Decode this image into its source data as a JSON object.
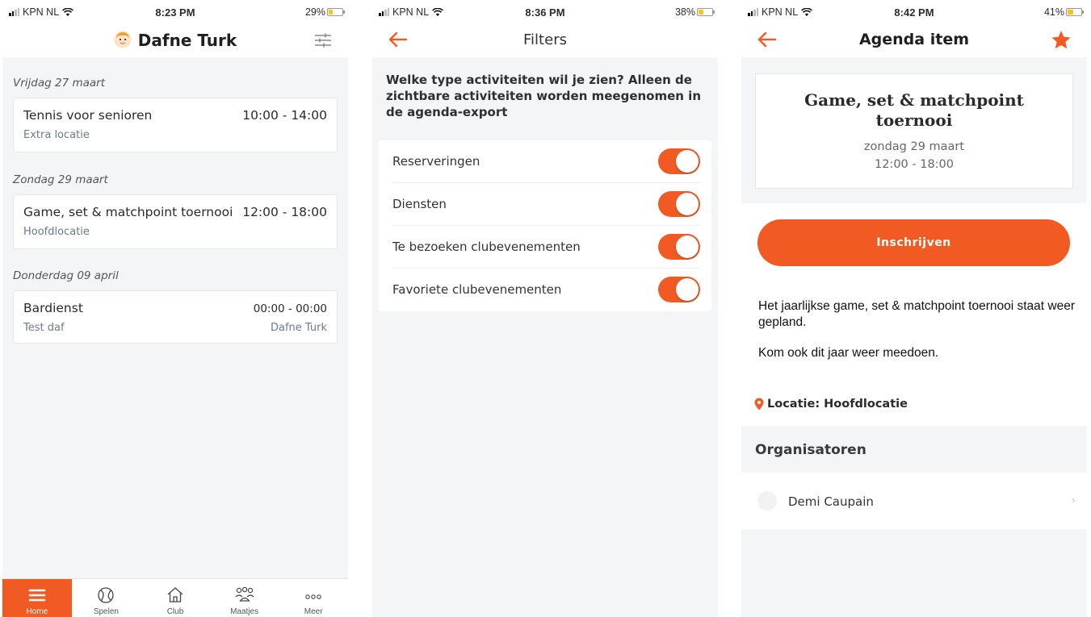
{
  "colors": {
    "accent": "#f15a22",
    "background": "#f4f5f7",
    "card": "#ffffff",
    "muted_text": "#6b7a8a"
  },
  "screens": [
    {
      "status": {
        "carrier": "KPN NL",
        "time": "8:23 PM",
        "battery": "29%",
        "battery_level": 0.29
      },
      "header": {
        "title": "Dafne Turk",
        "avatar_icon": "user-avatar-icon",
        "action_icon": "sliders-icon"
      },
      "sections": [
        {
          "date": "Vrijdag 27 maart",
          "events": [
            {
              "title": "Tennis voor senioren",
              "time": "10:00 - 14:00",
              "location": "Extra locatie",
              "extra": ""
            }
          ]
        },
        {
          "date": "Zondag 29 maart",
          "events": [
            {
              "title": "Game, set & matchpoint toernooi",
              "time": "12:00 - 18:00",
              "location": "Hoofdlocatie",
              "extra": ""
            }
          ]
        },
        {
          "date": "Donderdag 09 april",
          "events": [
            {
              "title": "Bardienst",
              "time": "00:00 - 00:00",
              "location": "Test daf",
              "extra": "Dafne Turk"
            }
          ]
        }
      ],
      "tabs": [
        {
          "label": "Home",
          "icon": "menu-icon",
          "active": true
        },
        {
          "label": "Spelen",
          "icon": "tennis-ball-icon",
          "active": false
        },
        {
          "label": "Club",
          "icon": "house-icon",
          "active": false
        },
        {
          "label": "Maatjes",
          "icon": "people-icon",
          "active": false
        },
        {
          "label": "Meer",
          "icon": "more-icon",
          "active": false
        }
      ]
    },
    {
      "status": {
        "carrier": "KPN NL",
        "time": "8:36 PM",
        "battery": "38%",
        "battery_level": 0.38
      },
      "header": {
        "title": "Filters",
        "back_icon": "back-arrow-icon"
      },
      "intro": "Welke type activiteiten wil je zien? Alleen de zichtbare activiteiten worden meegenomen in de agenda-export",
      "filters": [
        {
          "label": "Reserveringen",
          "on": true
        },
        {
          "label": "Diensten",
          "on": true
        },
        {
          "label": "Te bezoeken clubevenementen",
          "on": true
        },
        {
          "label": "Favoriete clubevenementen",
          "on": true
        }
      ]
    },
    {
      "status": {
        "carrier": "KPN NL",
        "time": "8:42 PM",
        "battery": "41%",
        "battery_level": 0.41
      },
      "header": {
        "title": "Agenda item",
        "back_icon": "back-arrow-icon",
        "favorite_icon": "star-icon"
      },
      "event": {
        "title_line1": "Game, set & matchpoint",
        "title_line2": "toernooi",
        "date": "zondag 29 maart",
        "time": "12:00 - 18:00"
      },
      "signup_label": "Inschrijven",
      "description": "Het jaarlijkse game, set & matchpoint toernooi staat weer gepland.",
      "description2": "Kom ook dit jaar weer meedoen.",
      "location": "Locatie: Hoofdlocatie",
      "organizers_title": "Organisatoren",
      "organizers": [
        {
          "name": "Demi Caupain"
        }
      ]
    }
  ]
}
